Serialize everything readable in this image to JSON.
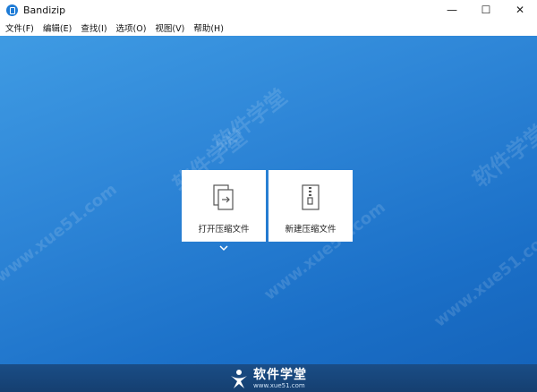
{
  "window": {
    "title": "Bandizip",
    "controls": {
      "minimize": "—",
      "maximize": "☐",
      "close": "✕"
    }
  },
  "menu": {
    "items": [
      {
        "label": "文件(F)"
      },
      {
        "label": "编辑(E)"
      },
      {
        "label": "查找(I)"
      },
      {
        "label": "选项(O)"
      },
      {
        "label": "视图(V)"
      },
      {
        "label": "帮助(H)"
      }
    ]
  },
  "main": {
    "cards": [
      {
        "label": "打开压缩文件",
        "icon": "open-archive-icon"
      },
      {
        "label": "新建压缩文件",
        "icon": "new-archive-icon"
      }
    ],
    "expand_icon": "chevron-down-icon"
  },
  "watermark": {
    "site_text": "软件学堂",
    "url_text": "www.xue51.com"
  },
  "footer": {
    "logo_text": "软件学堂",
    "logo_url": "www.xue51.com"
  },
  "colors": {
    "accent": "#1e7bd6",
    "main_background": "#2f87d8",
    "footer_background": "#153f70"
  }
}
